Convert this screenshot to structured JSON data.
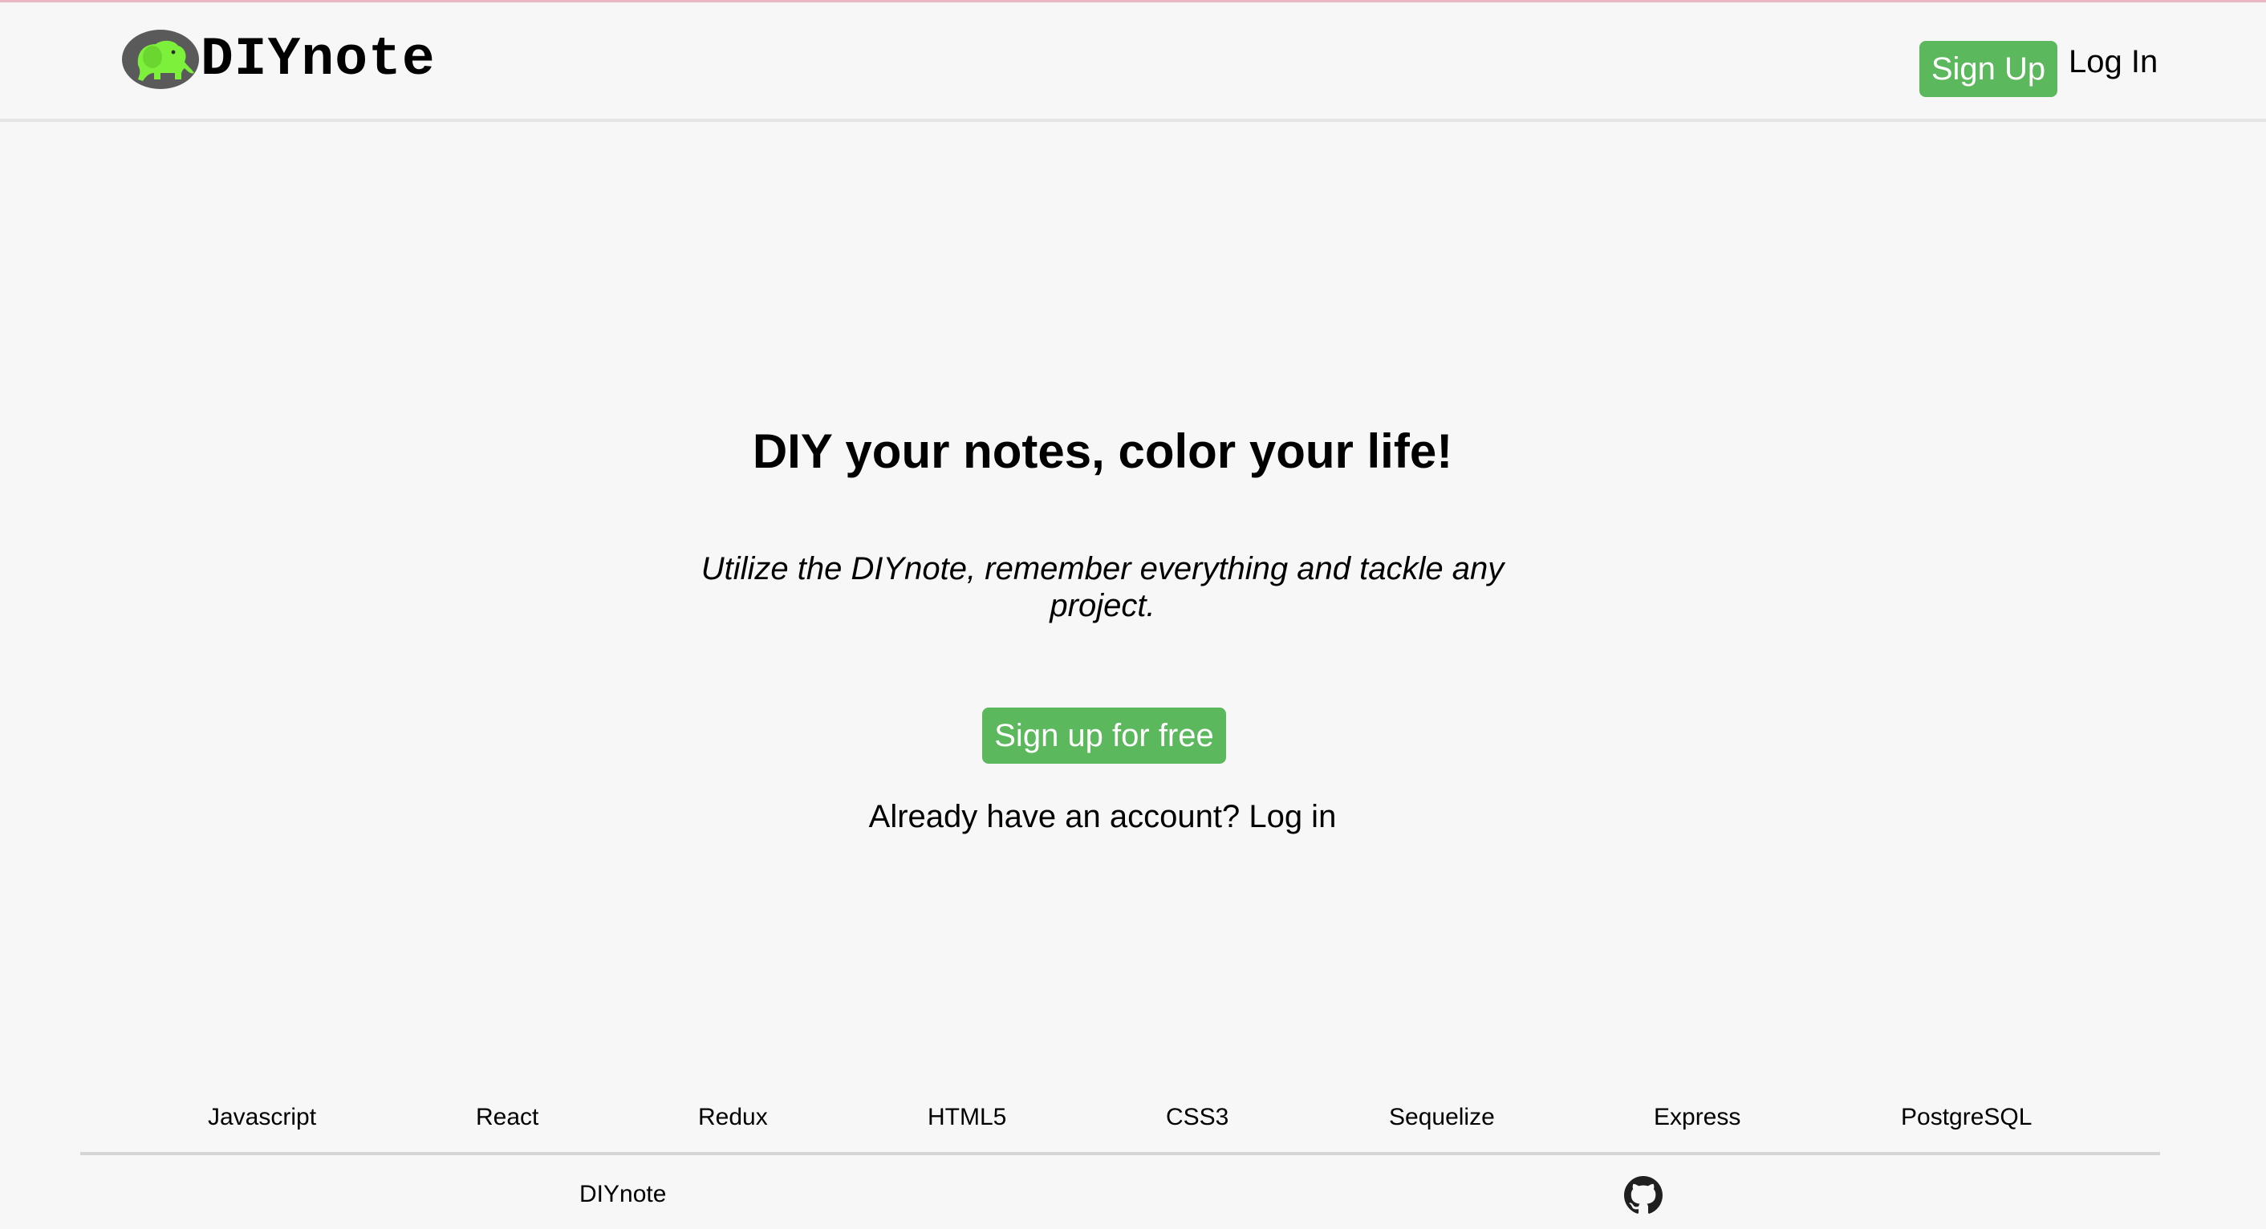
{
  "header": {
    "logo_text": "DIYnote",
    "signup_label": "Sign Up",
    "login_label": "Log In"
  },
  "hero": {
    "title": "DIY your notes, color your life!",
    "subtitle": "Utilize the DIYnote, remember everything and tackle any project.",
    "cta_label": "Sign up for free",
    "login_prompt": "Already have an account? Log in"
  },
  "footer": {
    "technologies": [
      "Javascript",
      "React",
      "Redux",
      "HTML5",
      "CSS3",
      "Sequelize",
      "Express",
      "PostgreSQL"
    ],
    "brand": "DIYnote",
    "github_icon": "github-icon"
  },
  "colors": {
    "accent": "#5cb85c",
    "background": "#f7f7f7",
    "logo_circle": "#5a5a5a",
    "logo_elephant": "#7cf03a"
  }
}
